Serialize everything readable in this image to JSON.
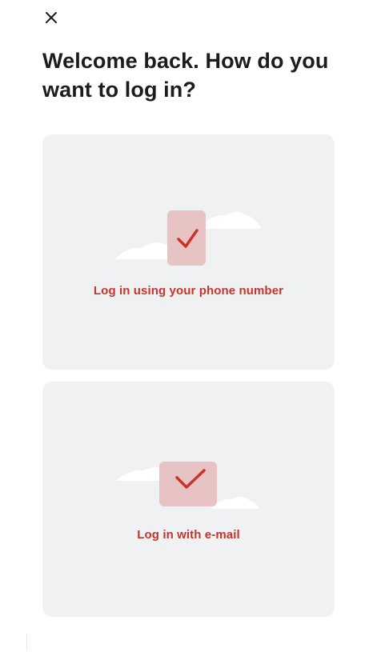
{
  "header": {
    "close_icon": "close-icon"
  },
  "title": "Welcome back. How do you want to log in?",
  "options": [
    {
      "label": "Log in using your phone number",
      "icon": "checkbox-check-icon"
    },
    {
      "label": "Log in with e-mail",
      "icon": "checkbox-check-icon"
    }
  ],
  "colors": {
    "accent": "#c8332c",
    "card_background": "#f0f1f3",
    "check_tile": "#e8c3c4"
  }
}
